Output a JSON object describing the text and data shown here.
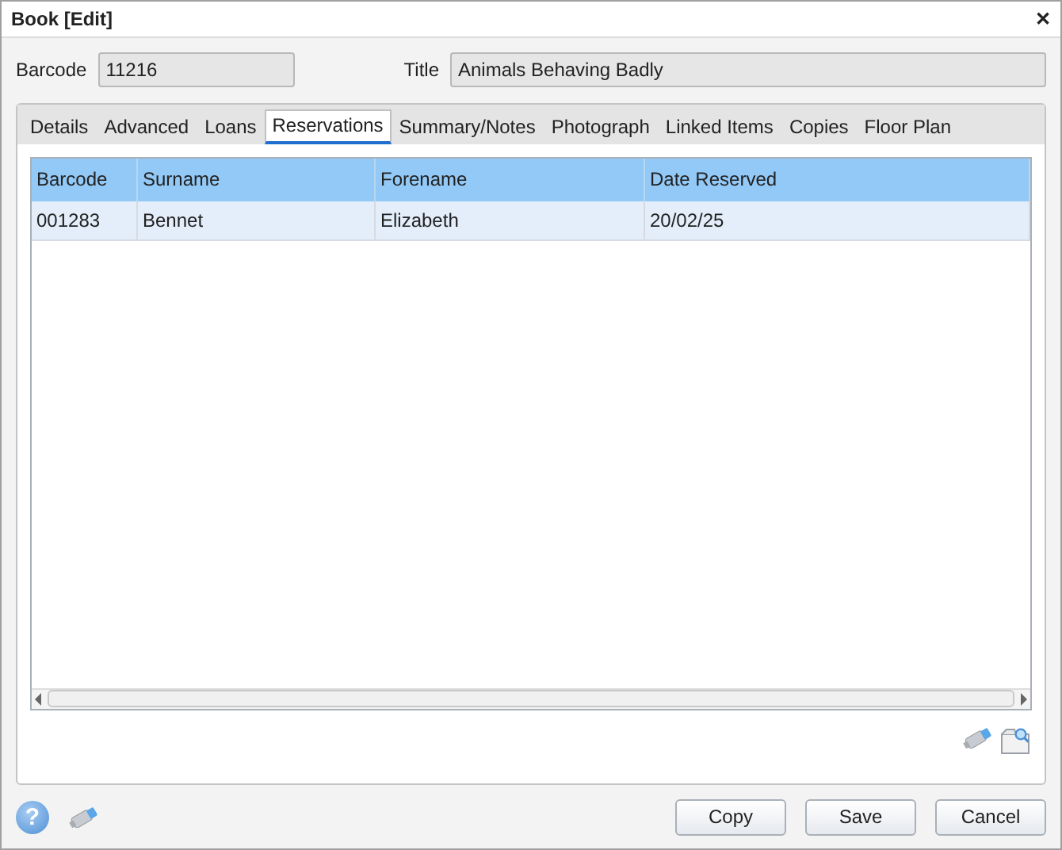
{
  "window": {
    "title": "Book [Edit]",
    "close": "✕"
  },
  "fields": [
    {
      "label": "Barcode",
      "value": "11216"
    },
    {
      "label": "Title",
      "value": "Animals Behaving Badly"
    }
  ],
  "tabs": [
    {
      "label": "Details",
      "selected": false
    },
    {
      "label": "Advanced",
      "selected": false
    },
    {
      "label": "Loans",
      "selected": false
    },
    {
      "label": "Reservations",
      "selected": true
    },
    {
      "label": "Summary/Notes",
      "selected": false
    },
    {
      "label": "Photograph",
      "selected": false
    },
    {
      "label": "Linked Items",
      "selected": false
    },
    {
      "label": "Copies",
      "selected": false
    },
    {
      "label": "Floor Plan",
      "selected": false
    }
  ],
  "table": {
    "columns": [
      "Barcode",
      "Surname",
      "Forename",
      "Date Reserved"
    ],
    "rows": [
      {
        "cells": [
          "001283",
          "Bennet",
          "Elizabeth",
          "20/02/25"
        ],
        "selected": true
      }
    ]
  },
  "help": "?",
  "buttons": [
    "Copy",
    "Save",
    "Cancel"
  ]
}
